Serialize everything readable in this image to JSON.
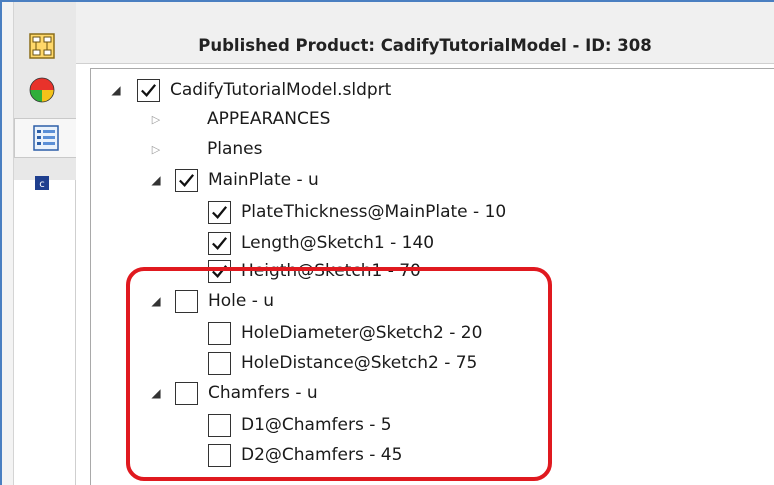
{
  "header": {
    "title": "Published Product: CadifyTutorialModel - ID: 308"
  },
  "toolbar": {
    "buttons": [
      {
        "icon": "tree-layout-icon"
      },
      {
        "icon": "appearance-ball-icon"
      },
      {
        "icon": "properties-list-icon"
      },
      {
        "icon": "cadify-logo-icon"
      }
    ]
  },
  "tree": {
    "root": {
      "label": "CadifyTutorialModel.sldprt",
      "checked": true
    },
    "appearances": {
      "label": "APPEARANCES"
    },
    "planes": {
      "label": "Planes"
    },
    "mainplate": {
      "label": "MainPlate - u",
      "checked": true,
      "items": [
        {
          "label": "PlateThickness@MainPlate - 10",
          "checked": true
        },
        {
          "label": "Length@Sketch1 - 140",
          "checked": true
        },
        {
          "label": "Heigth@Sketch1 - 70",
          "checked": true
        }
      ]
    },
    "hole": {
      "label": "Hole - u",
      "checked": false,
      "items": [
        {
          "label": "HoleDiameter@Sketch2 - 20",
          "checked": false
        },
        {
          "label": "HoleDistance@Sketch2 - 75",
          "checked": false
        }
      ]
    },
    "chamfers": {
      "label": "Chamfers - u",
      "checked": false,
      "items": [
        {
          "label": "D1@Chamfers - 5",
          "checked": false
        },
        {
          "label": "D2@Chamfers - 45",
          "checked": false
        }
      ]
    }
  },
  "colors": {
    "highlight": "#e0191f",
    "frame": "#4a7fc1"
  }
}
